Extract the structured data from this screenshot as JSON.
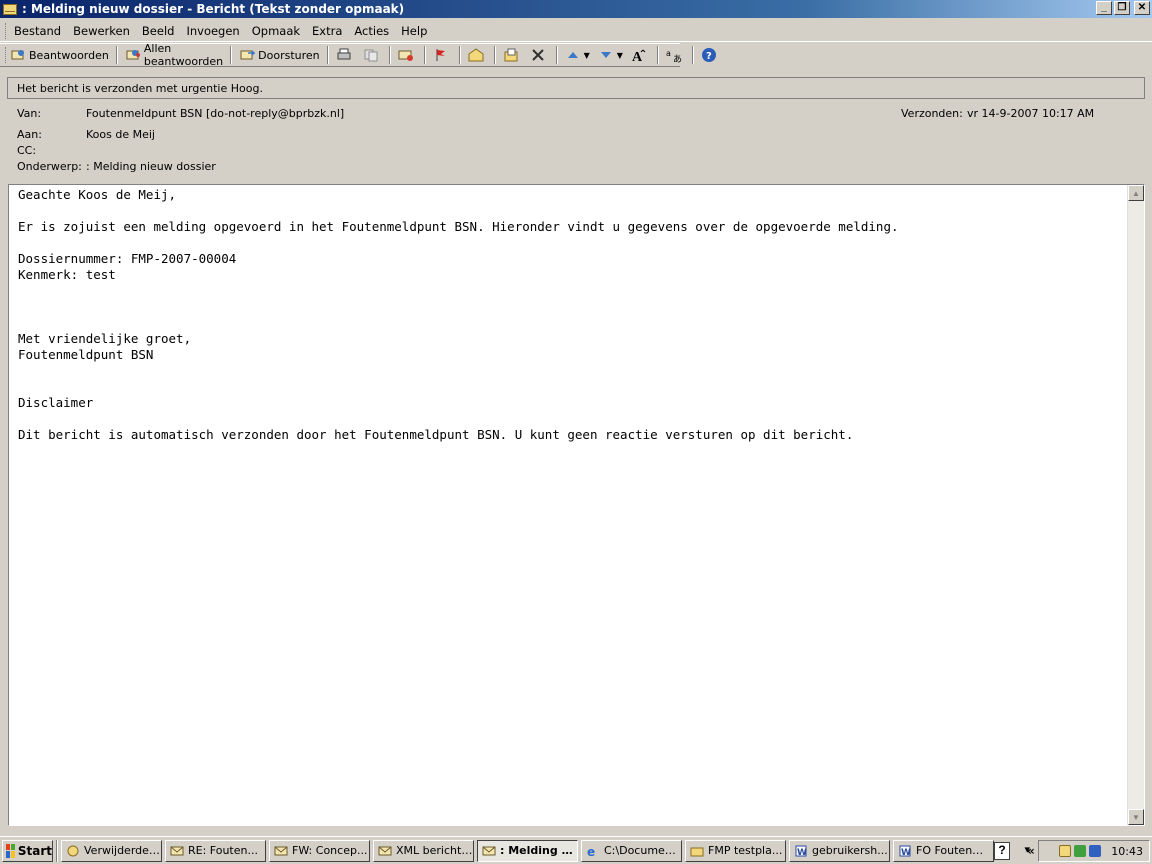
{
  "window": {
    "title": ": Melding nieuw dossier - Bericht (Tekst zonder opmaak)",
    "minimize": "_",
    "maximize": "❐",
    "close": "✕"
  },
  "menu": [
    "Bestand",
    "Bewerken",
    "Beeld",
    "Invoegen",
    "Opmaak",
    "Extra",
    "Acties",
    "Help"
  ],
  "toolbar": {
    "reply": "Beantwoorden",
    "reply_all": "Allen beantwoorden",
    "forward": "Doorsturen"
  },
  "infobar": "Het bericht is verzonden met urgentie Hoog.",
  "headers": {
    "from_label": "Van:",
    "from_value": "Foutenmeldpunt BSN [do-not-reply@bprbzk.nl]",
    "to_label": "Aan:",
    "to_value": "Koos de Meij",
    "cc_label": "CC:",
    "cc_value": "",
    "subject_label": "Onderwerp:",
    "subject_value": ": Melding nieuw dossier",
    "sent_label": "Verzonden:",
    "sent_value": "vr 14-9-2007 10:17 AM"
  },
  "body": "Geachte Koos de Meij,\n\nEr is zojuist een melding opgevoerd in het Foutenmeldpunt BSN. Hieronder vindt u gegevens over de opgevoerde melding.\n\nDossiernummer: FMP-2007-00004\nKenmerk: test\n\n\n\nMet vriendelijke groet,\nFoutenmeldpunt BSN\n\n\nDisclaimer\n\nDit bericht is automatisch verzonden door het Foutenmeldpunt BSN. U kunt geen reactie versturen op dit bericht.",
  "taskbar": {
    "start": "Start",
    "tasks": [
      {
        "label": "Verwijderde ...",
        "icon": "outlook-icon"
      },
      {
        "label": "RE: Fouten...",
        "icon": "mail-icon"
      },
      {
        "label": "FW: Concep...",
        "icon": "mail-icon"
      },
      {
        "label": "XML bericht ...",
        "icon": "mail-icon"
      },
      {
        "label": ": Melding ni...",
        "icon": "mail-icon",
        "active": true
      },
      {
        "label": "C:\\Documen...",
        "icon": "ie-icon"
      },
      {
        "label": "FMP testpla...",
        "icon": "folder-icon"
      },
      {
        "label": "gebruikersh...",
        "icon": "word-icon"
      },
      {
        "label": "FO Foutenm...",
        "icon": "word-icon"
      }
    ],
    "clock": "10:43",
    "help": "?"
  }
}
